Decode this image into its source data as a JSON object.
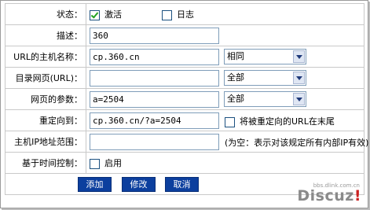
{
  "form": {
    "status_label": "状态：",
    "status_opt1": "激活",
    "status_opt1_checked": true,
    "status_opt2": "日志",
    "status_opt2_checked": false,
    "desc_label": "描述：",
    "desc_value": "360",
    "host_label": "URL的主机名称：",
    "host_value": "cp.360.cn",
    "host_select": "相同",
    "dir_label": "目录网页(URL)：",
    "dir_value": "",
    "dir_select": "全部",
    "param_label": "网页的参数：",
    "param_value": "a=2504",
    "param_select": "全部",
    "redirect_label": "重定向到：",
    "redirect_value": "cp.360.cn/?a=2504",
    "redirect_check_label": "将被重定向的URL在末尾",
    "redirect_checked": false,
    "iprange_label": "主机IP地址范围：",
    "iprange_value": "",
    "iprange_note": "(为空：表示对该规定所有内部IP有效)",
    "time_label": "基于时间控制：",
    "time_opt": "启用",
    "time_checked": false
  },
  "buttons": {
    "add": "添加",
    "modify": "修改",
    "cancel": "取消"
  },
  "watermark": {
    "main": "Discuz",
    "bang": "!",
    "sub": "bbs.dlink.com.cn"
  },
  "colors": {
    "button_bg": "#0c3f9e",
    "check_green": "#21a121"
  }
}
